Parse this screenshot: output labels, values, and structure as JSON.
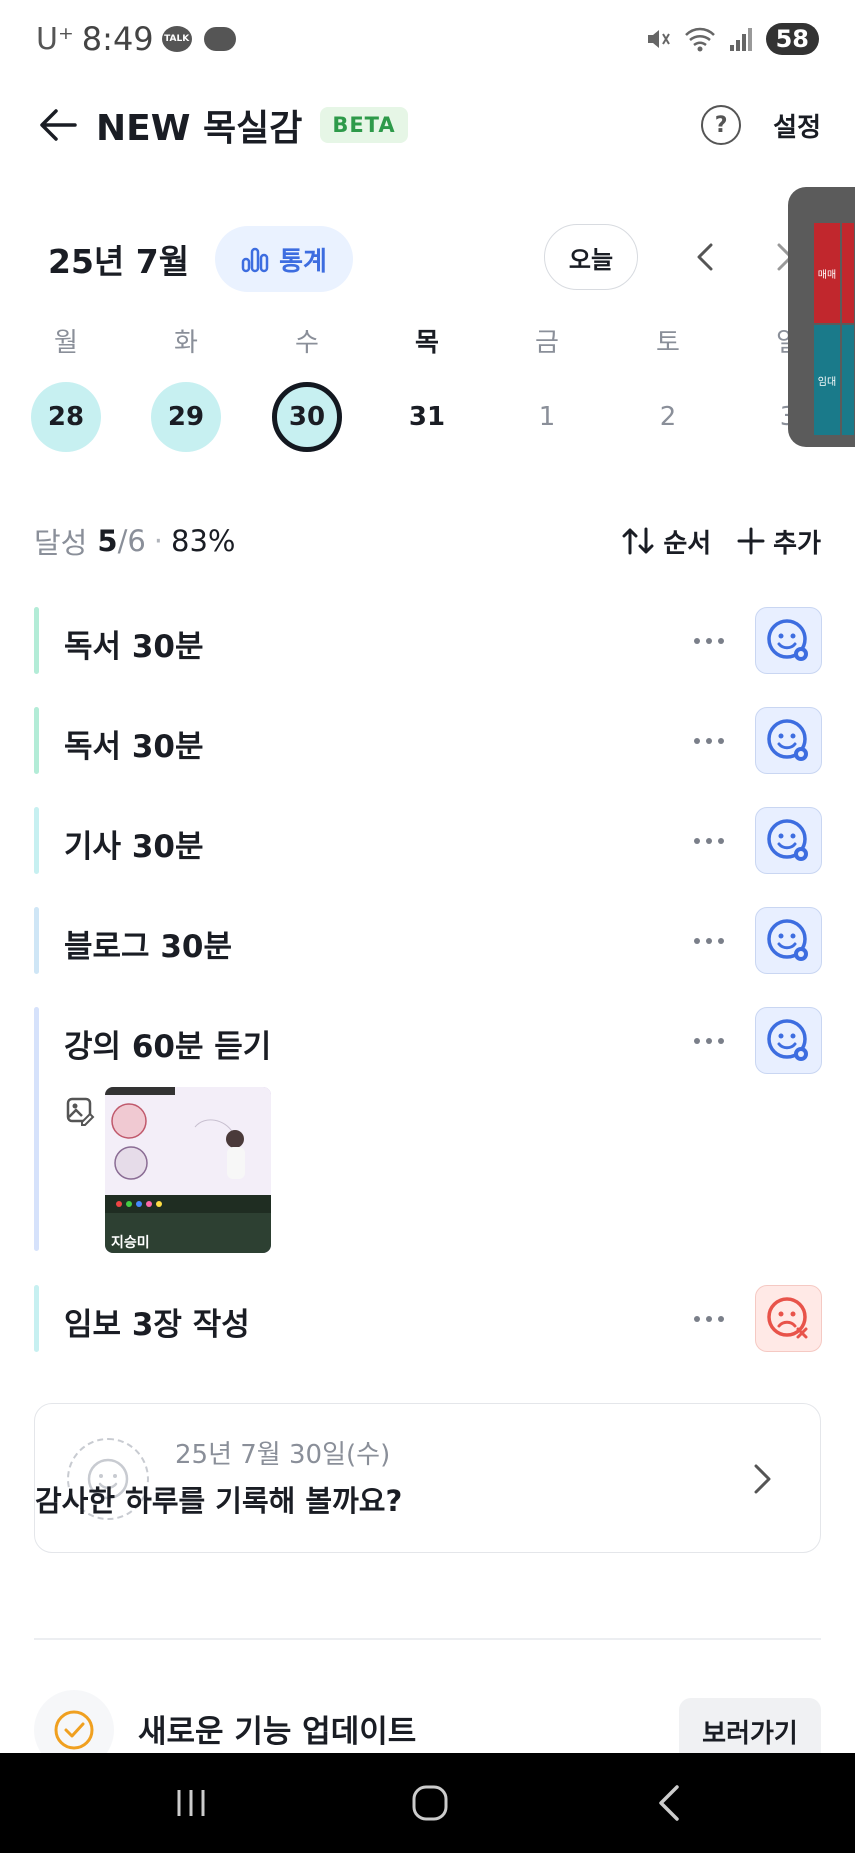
{
  "status_bar": {
    "carrier": "U⁺",
    "time": "8:49",
    "talk": "TALK",
    "battery": "58"
  },
  "header": {
    "title": "NEW 목실감",
    "beta": "BETA",
    "settings": "설정"
  },
  "calendar": {
    "month": "25년 7월",
    "stats_label": "통계",
    "today_label": "오늘",
    "weekdays": [
      "월",
      "화",
      "수",
      "목",
      "금",
      "토",
      "일"
    ],
    "days": [
      "28",
      "29",
      "30",
      "31",
      "1",
      "2",
      "3"
    ]
  },
  "overlay": {
    "cell1": "매매",
    "cell2": "임대"
  },
  "achievement": {
    "label": "달성",
    "done": "5",
    "total": "/6",
    "percent": "83%",
    "sort_label": "순서",
    "add_label": "추가"
  },
  "tasks": [
    {
      "name": "독서 30분",
      "status": "ok",
      "bar_color": "#b3ecd7"
    },
    {
      "name": "독서 30분",
      "status": "ok",
      "bar_color": "#b3ecd7"
    },
    {
      "name": "기사 30분",
      "status": "ok",
      "bar_color": "#c7f0f1"
    },
    {
      "name": "블로그 30분",
      "status": "ok",
      "bar_color": "#cfe6f6"
    },
    {
      "name": "강의 60분 듣기",
      "status": "ok",
      "bar_color": "#d6e2fb"
    },
    {
      "name": "임보 3장 작성",
      "status": "fail",
      "bar_color": "#c7f0f1"
    }
  ],
  "photo": {
    "caption": "지승미"
  },
  "gratitude": {
    "date": "25년 7월 30일(수)",
    "prompt": "감사한 하루를 기록해 볼까요?"
  },
  "update": {
    "text": "새로운 기능 업데이트",
    "button": "보러가기"
  },
  "colors": {
    "accent_blue": "#3d6de0",
    "done_day": "#c7f0f1",
    "fail": "#e8534a",
    "beta_green": "#2e9a4a"
  }
}
